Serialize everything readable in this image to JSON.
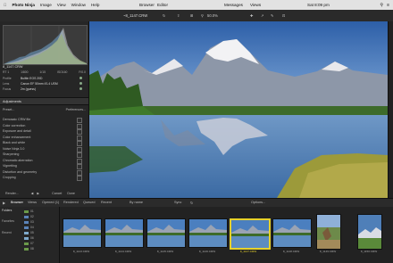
{
  "menubar": {
    "items": [
      "Photo Ninja",
      "Image",
      "View",
      "Window",
      "Help"
    ],
    "status": [
      "Browser",
      "Editor",
      "Messages",
      "Views",
      "Sat 8:09 pm"
    ]
  },
  "toolbar": {
    "file": "~8_1147.CRW",
    "zoom": "50.0%",
    "zoom_icon": "magnify-icon"
  },
  "sidebar": {
    "filename": "8_1147.CRW",
    "exif": [
      "RT 1",
      "1/800",
      "1/15",
      "ISO160",
      "F/0.0"
    ],
    "meta": [
      {
        "k": "Profile",
        "v": "Builtin EOS 20D"
      },
      {
        "k": "Lens",
        "v": "Canon EF 50mm f/1.4 USM"
      },
      {
        "k": "Focus",
        "v": "2m (guess)"
      }
    ],
    "adjustments_title": "Adjustments",
    "preset_label": "Preset...",
    "preferences_label": "Preferences...",
    "adjustments": [
      "Demosaic CRW file",
      "Color correction",
      "Exposure and detail",
      "Color enhancement",
      "Black and white",
      "Noise Ninja 3.0",
      "Sharpening",
      "Chromatic aberration",
      "Vignetting",
      "Distortion and geometry",
      "Cropping"
    ],
    "footer": {
      "render": "Render...",
      "cancel": "Cancel",
      "done": "Done"
    }
  },
  "browser": {
    "tabs": [
      "Browser",
      "Views",
      "Opened (1)",
      "Rendered",
      "Queued",
      "Recent"
    ],
    "sort": "By name",
    "sync": "Sync",
    "options": "Options...",
    "folders_title": "Folders",
    "folder_labels": [
      "Favorites",
      "Recent"
    ],
    "folder_items": [
      "01",
      "02",
      "03",
      "04",
      "05",
      "06",
      "07",
      "08"
    ]
  },
  "filmstrip": {
    "thumbnails": [
      {
        "name": "8_1143.CRW",
        "selected": false
      },
      {
        "name": "8_1144.CRW",
        "selected": false
      },
      {
        "name": "8_1145.CRW",
        "selected": false
      },
      {
        "name": "8_1146.CRW",
        "selected": false
      },
      {
        "name": "8_1147.CRW",
        "selected": true
      },
      {
        "name": "8_1148.CRW",
        "selected": false
      },
      {
        "name": "8_1149.CRW",
        "selected": false
      },
      {
        "name": "8_1150.CRW",
        "selected": false
      }
    ]
  },
  "colors": {
    "selection": "#e6d12a",
    "accent_dot": "#88aa88"
  }
}
